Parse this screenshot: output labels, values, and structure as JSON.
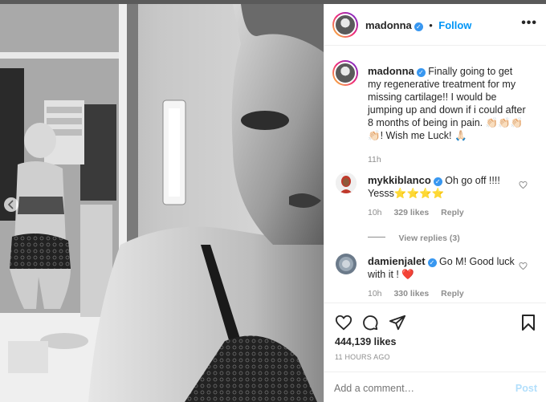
{
  "post": {
    "username": "madonna",
    "follow_label": "Follow",
    "more_label": "•••"
  },
  "caption": {
    "username": "madonna",
    "text": "Finally going to get my regenerative treatment for my missing cartilage!! I would be jumping up and down if i could after 8 months of being in pain. 👏🏻👏🏻👏🏻👏🏻! Wish me Luck! 🙏🏻",
    "time": "11h"
  },
  "comments": [
    {
      "username": "mykkiblanco",
      "text": "Oh go off !!!! Yesss⭐⭐⭐⭐",
      "time": "10h",
      "likes": "329 likes",
      "reply_label": "Reply",
      "view_replies": "View replies (3)"
    },
    {
      "username": "damienjalet",
      "text": "Go M! Good luck with it ! ❤️",
      "time": "10h",
      "likes": "330 likes",
      "reply_label": "Reply"
    }
  ],
  "stats": {
    "likes": "444,139 likes",
    "timestamp": "11 HOURS AGO"
  },
  "add_comment": {
    "placeholder": "Add a comment…",
    "post_label": "Post"
  },
  "colors": {
    "link_blue": "#0095f6",
    "verified_blue": "#3897f0",
    "heart_red": "#ed4956",
    "muted": "#8e8e8e"
  }
}
